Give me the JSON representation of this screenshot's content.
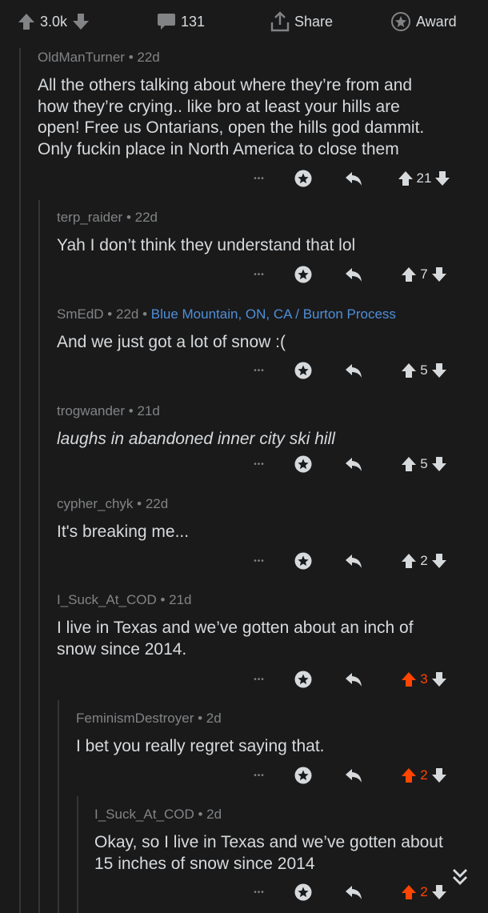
{
  "post_bar": {
    "score": "3.0k",
    "comments": "131",
    "share_label": "Share",
    "award_label": "Award"
  },
  "colors": {
    "background": "#1a1a1b",
    "text": "#d7dadc",
    "muted": "#818384",
    "upvoted": "#ff4500",
    "flair": "#4f8fd9"
  },
  "comments": [
    {
      "author": "OldManTurner",
      "age": "22d",
      "flair": "",
      "text": [
        "All the others talking about where they’re from and",
        "how they’re crying.. like bro at least your hills are",
        "open! Free us Ontarians, open the hills god dammit.",
        "Only fuckin place in North America to close them"
      ],
      "score": "21",
      "upvoted": false
    },
    {
      "author": "terp_raider",
      "age": "22d",
      "flair": "",
      "text": [
        "Yah I don’t think they understand that lol"
      ],
      "score": "7",
      "upvoted": false
    },
    {
      "author": "SmEdD",
      "age": "22d",
      "flair": "Blue Mountain, ON, CA / Burton Process",
      "text": [
        "And we just got a lot of snow :("
      ],
      "score": "5",
      "upvoted": false
    },
    {
      "author": "trogwander",
      "age": "21d",
      "flair": "",
      "text": [
        "laughs in abandoned inner city ski hill"
      ],
      "score": "5",
      "upvoted": false,
      "italic": true
    },
    {
      "author": "cypher_chyk",
      "age": "22d",
      "flair": "",
      "text": [
        "It's breaking me..."
      ],
      "score": "2",
      "upvoted": false
    },
    {
      "author": "I_Suck_At_COD",
      "age": "21d",
      "flair": "",
      "text": [
        "I live in Texas and we’ve gotten about an inch of",
        "snow since 2014."
      ],
      "score": "3",
      "upvoted": true
    },
    {
      "author": "FeminismDestroyer",
      "age": "2d",
      "flair": "",
      "text": [
        "I bet you really regret saying that."
      ],
      "score": "2",
      "upvoted": true
    },
    {
      "author": "I_Suck_At_COD",
      "age": "2d",
      "flair": "",
      "text": [
        "Okay, so I live in Texas and we’ve gotten about",
        "15 inches of snow since 2014"
      ],
      "score": "2",
      "upvoted": true
    }
  ],
  "icons": {
    "more": "more-dots-icon",
    "award": "award-icon",
    "reply": "reply-icon",
    "upvote": "upvote-arrow-icon",
    "downvote": "downvote-arrow-icon",
    "scroll": "double-chevron-down-icon"
  }
}
